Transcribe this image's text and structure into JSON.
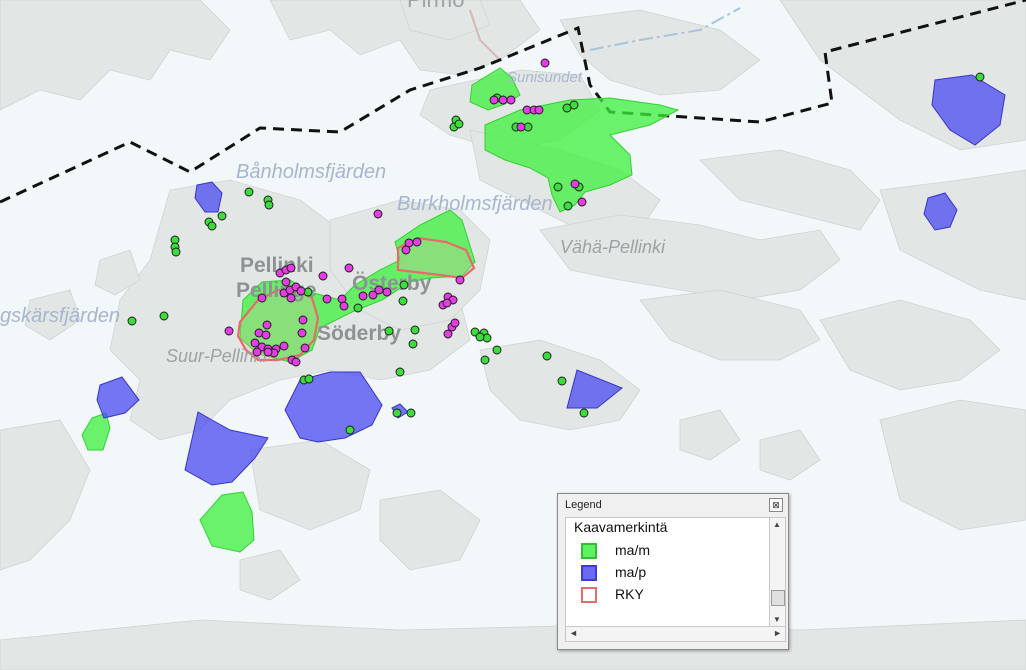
{
  "map": {
    "place_labels": [
      {
        "id": "pirmo",
        "text": "Pirmo"
      },
      {
        "id": "sunisundet",
        "text": "Sunisundet"
      },
      {
        "id": "banholmsfjarden",
        "text": "Bånholmsfjärden"
      },
      {
        "id": "burkholmsfjarden",
        "text": "Burkholmsfjärden"
      },
      {
        "id": "vaha-pellinki",
        "text": "Vähä-Pellinki"
      },
      {
        "id": "pellinki",
        "text": "Pellinki"
      },
      {
        "id": "pellinge",
        "text": "Pellinge"
      },
      {
        "id": "osterby",
        "text": "Österby"
      },
      {
        "id": "soderby",
        "text": "Söderby"
      },
      {
        "id": "suur-pellinki",
        "text": "Suur-Pellinki"
      },
      {
        "id": "gskarsfjarden",
        "text": "gskärsfjärden"
      }
    ],
    "colors": {
      "water": "#f2f7f9",
      "land": "#e4e8e6",
      "ma_m_fill": "#3ef03e",
      "ma_p_fill": "#4a4af0",
      "rky_outline": "#e86a6a",
      "green_point": "#3ddc3d",
      "magenta_point": "#e23ee2",
      "boundary": "#111111"
    }
  },
  "legend": {
    "title": "Legend",
    "close_glyph": "⊠",
    "heading": "Kaavamerkintä",
    "items": [
      {
        "label": "ma/m",
        "fill": "#5ff05f",
        "stroke": "#2fc02f"
      },
      {
        "label": "ma/p",
        "fill": "#6b6bf2",
        "stroke": "#3c3cd0"
      },
      {
        "label": "RKY",
        "fill": "#ffffff",
        "stroke": "#e86a6a"
      }
    ],
    "scroll_up": "▲",
    "scroll_down": "▼",
    "scroll_left": "◄",
    "scroll_right": "►"
  }
}
